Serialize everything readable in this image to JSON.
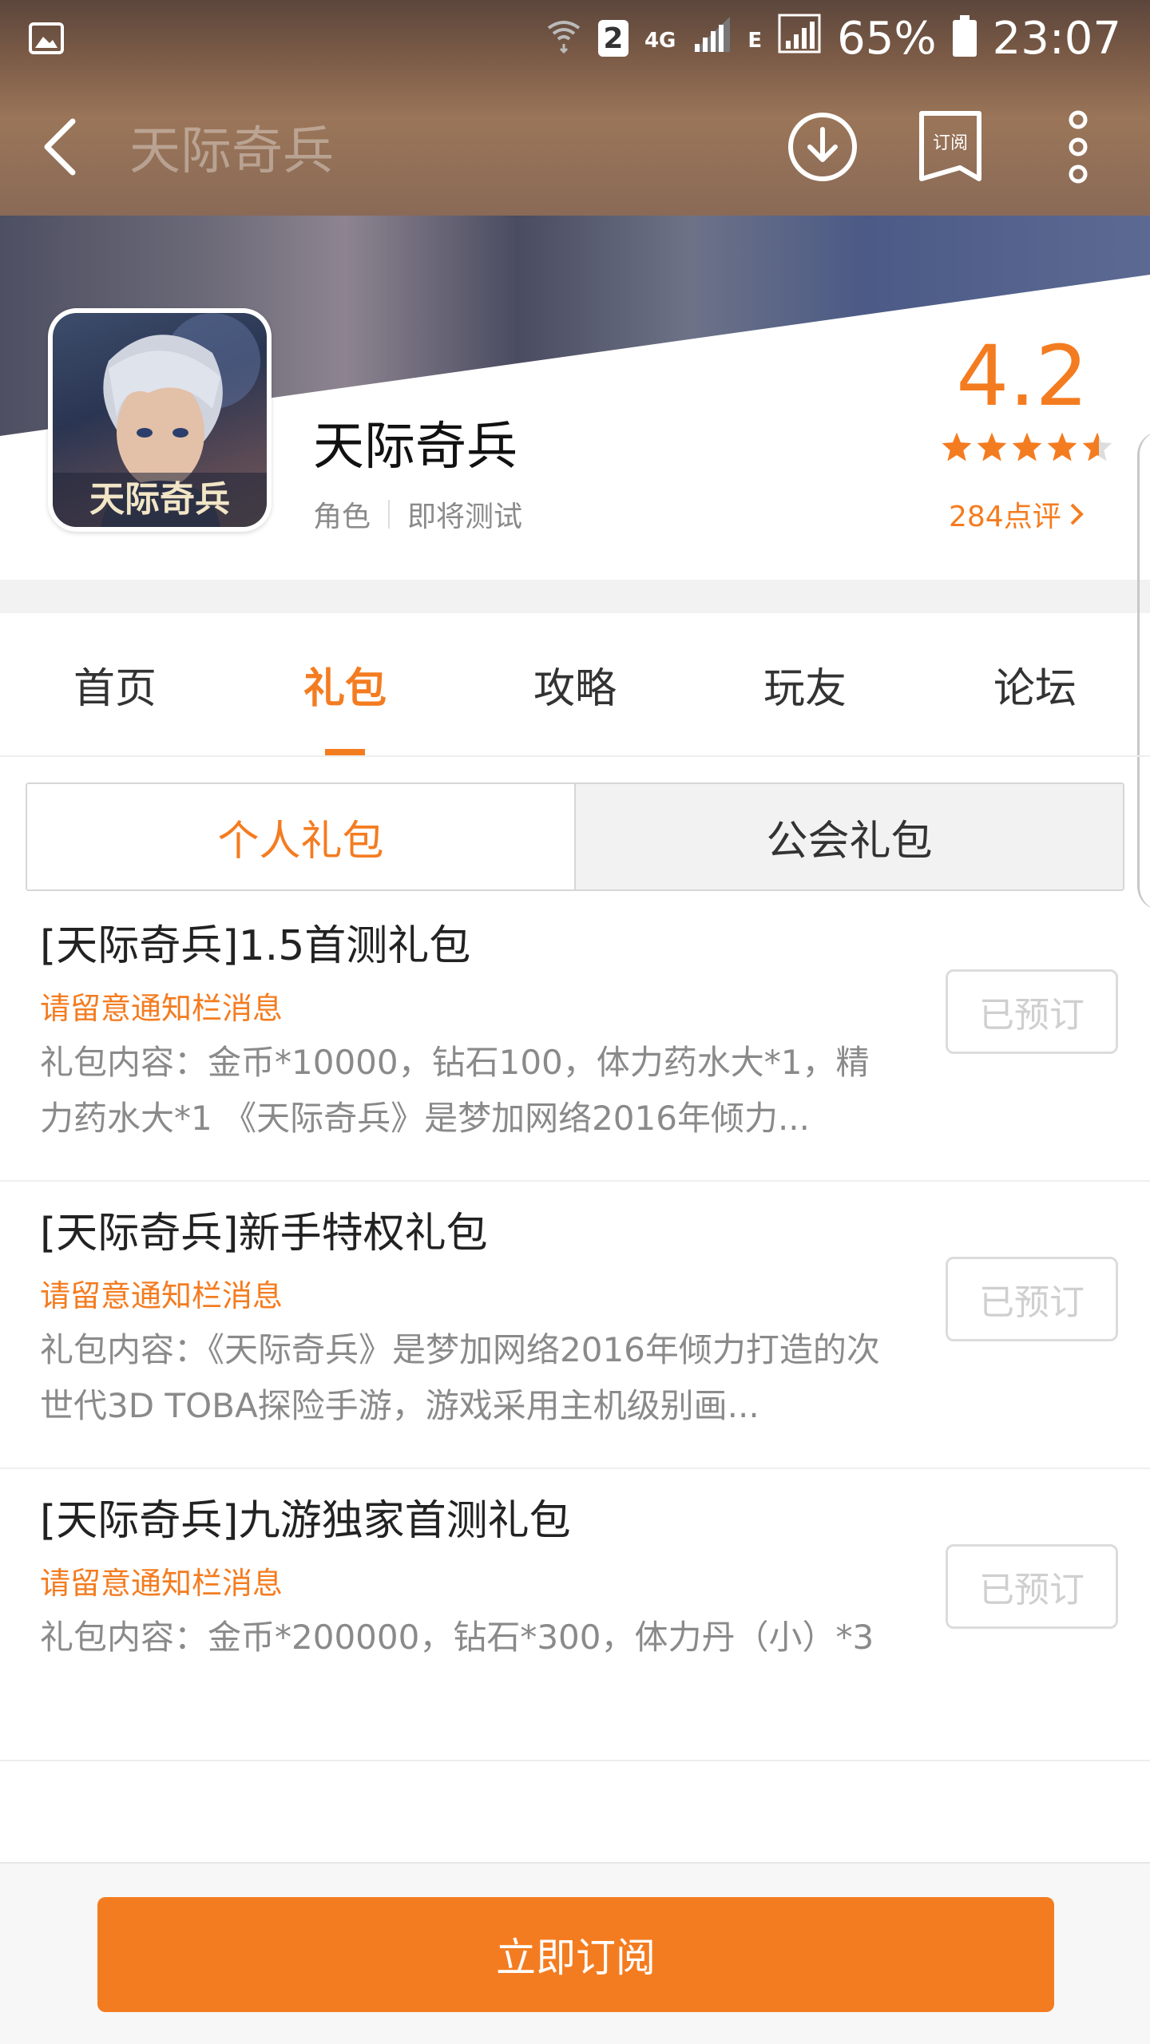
{
  "status_bar": {
    "sim_badge": "2",
    "network_4g": "4G",
    "network_e": "E",
    "battery": "65%",
    "time": "23:07"
  },
  "app_bar": {
    "title": "天际奇兵",
    "subscribe_icon_text": "订阅"
  },
  "app": {
    "name": "天际奇兵",
    "tags": [
      "角色",
      "即将测试"
    ],
    "rating": "4.2",
    "stars": 4.5,
    "reviews": "284点评",
    "icon_text": "天际奇兵"
  },
  "tabs": [
    {
      "label": "首页",
      "active": false
    },
    {
      "label": "礼包",
      "active": true
    },
    {
      "label": "攻略",
      "active": false
    },
    {
      "label": "玩友",
      "active": false
    },
    {
      "label": "论坛",
      "active": false
    }
  ],
  "segment": {
    "personal": "个人礼包",
    "guild": "公会礼包"
  },
  "gifts": [
    {
      "title": "[天际奇兵]1.5首测礼包",
      "notice": "请留意通知栏消息",
      "content": "礼包内容：金币*10000，钻石100，体力药水大*1，精力药水大*1 《天际奇兵》是梦加网络2016年倾力...",
      "action": "已预订"
    },
    {
      "title": "[天际奇兵]新手特权礼包",
      "notice": "请留意通知栏消息",
      "content": "礼包内容：《天际奇兵》是梦加网络2016年倾力打造的次世代3D TOBA探险手游，游戏采用主机级别画...",
      "action": "已预订"
    },
    {
      "title": "[天际奇兵]九游独家首测礼包",
      "notice": "请留意通知栏消息",
      "content": "礼包内容：金币*200000，钻石*300，体力丹（小）*3",
      "action": "已预订"
    }
  ],
  "bottom": {
    "subscribe_now": "立即订阅"
  },
  "colors": {
    "accent": "#f47c20"
  }
}
